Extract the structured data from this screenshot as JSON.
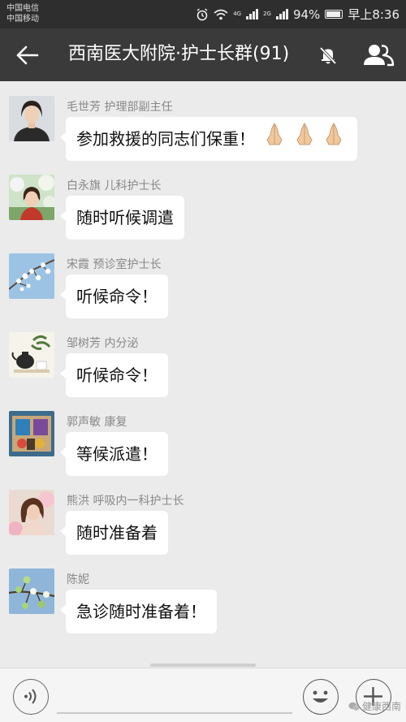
{
  "status_bar": {
    "carrier_1": "中国电信",
    "carrier_2": "中国移动",
    "network_1": "4G",
    "network_2": "2G",
    "battery": "94%",
    "time": "早上8:36"
  },
  "nav": {
    "title": "西南医大附院·护士长群(91)",
    "icons": [
      "back-arrow-icon",
      "mute-bell-icon",
      "group-members-icon"
    ]
  },
  "messages": [
    {
      "sender": "毛世芳 护理部副主任",
      "text": "参加救援的同志们保重！",
      "emoji": "pray-hands x3"
    },
    {
      "sender": "白永旗 儿科护士长",
      "text": "随时听候调遣"
    },
    {
      "sender": "宋霞 预诊室护士长",
      "text": "听候命令！"
    },
    {
      "sender": "邹树芳 内分泌",
      "text": "听候命令！"
    },
    {
      "sender": "郭声敏 康复",
      "text": "等候派遣！"
    },
    {
      "sender": "熊洪 呼吸内一科护士长",
      "text": "随时准备着"
    },
    {
      "sender": "陈妮",
      "text": "急诊随时准备着！"
    }
  ],
  "input_bar": {
    "icons": [
      "voice-icon",
      "emoji-icon",
      "plus-icon"
    ],
    "watermark": "健康西南"
  },
  "colors": {
    "nav_bg": "#3a3a3a",
    "status_bg": "#2e2e2e",
    "chat_bg": "#ebebeb",
    "bubble": "#ffffff"
  }
}
